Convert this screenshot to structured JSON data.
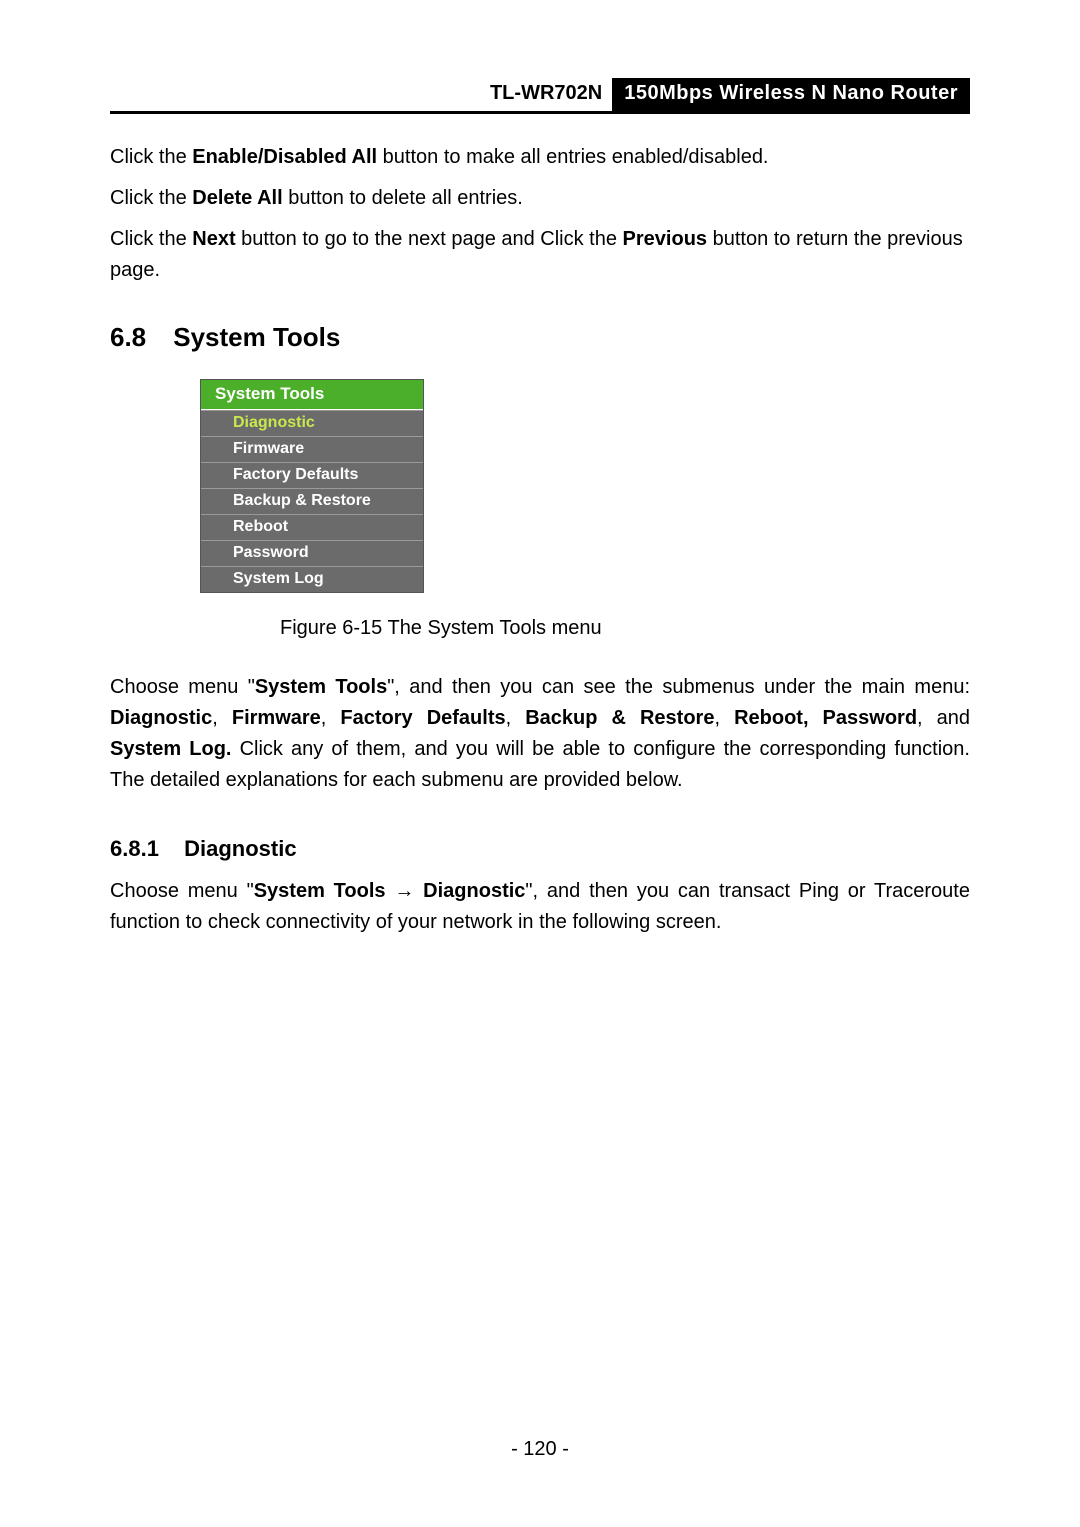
{
  "header": {
    "model": "TL-WR702N",
    "desc": "150Mbps Wireless N Nano Router"
  },
  "intro": {
    "p1_a": "Click the ",
    "p1_b": "Enable/Disabled All",
    "p1_c": " button to make all entries enabled/disabled.",
    "p2_a": "Click the ",
    "p2_b": "Delete All",
    "p2_c": " button to delete all entries.",
    "p3_a": "Click the ",
    "p3_b": "Next",
    "p3_c": " button to go to the next page and Click the ",
    "p3_d": "Previous",
    "p3_e": " button to return the previous page."
  },
  "section": {
    "num": "6.8",
    "title": "System Tools"
  },
  "menu": {
    "header": "System Tools",
    "items": [
      {
        "label": "Diagnostic",
        "active": true
      },
      {
        "label": "Firmware",
        "active": false
      },
      {
        "label": "Factory Defaults",
        "active": false
      },
      {
        "label": "Backup & Restore",
        "active": false
      },
      {
        "label": "Reboot",
        "active": false
      },
      {
        "label": "Password",
        "active": false
      },
      {
        "label": "System Log",
        "active": false
      }
    ]
  },
  "figure_caption": "Figure 6-15 The System Tools menu",
  "choose_para": {
    "t1": "Choose menu \"",
    "t2": "System Tools",
    "t3": "\", and then you can see the submenus under the main menu: ",
    "t4": "Diagnostic",
    "t5": ", ",
    "t6": "Firmware",
    "t7": ", ",
    "t8": "Factory Defaults",
    "t9": ", ",
    "t10": "Backup & Restore",
    "t11": ", ",
    "t12": "Reboot, Password",
    "t13": ", and ",
    "t14": "System Log.",
    "t15": " Click any of them, and you will be able to configure the corresponding function. The detailed explanations for each submenu are provided below."
  },
  "subheading": {
    "num": "6.8.1",
    "title": "Diagnostic"
  },
  "diag_para": {
    "t1": "Choose menu \"",
    "t2": "System Tools",
    "t3": " → ",
    "t4": "Diagnostic",
    "t5": "\", and then you can transact Ping or Traceroute function to check connectivity of your network in the following screen."
  },
  "page_number": "- 120 -"
}
